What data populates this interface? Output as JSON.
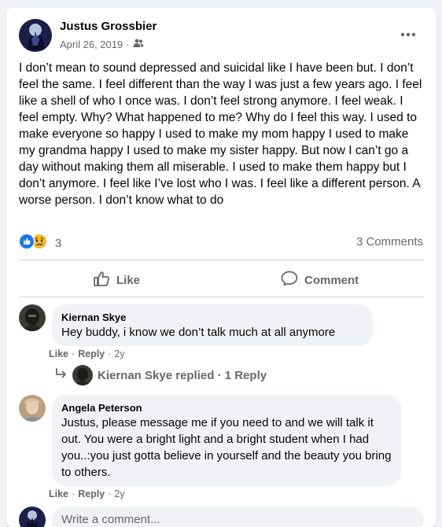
{
  "post": {
    "author": "Justus Grossbier",
    "date": "April 26, 2019",
    "separator": "·",
    "audience_icon": "friends-icon",
    "text": "I don’t mean to sound depressed and suicidal like I have been but. I don’t feel the same. I feel different than the way I was just a few years ago. I feel like a shell of who I once was. I don’t feel strong anymore. I feel weak. I feel empty. Why? What happened to me? Why do I feel this way. I used to make everyone so happy I used to make my mom happy I used to make my grandma happy I used to make my sister happy. But now I can’t go a day without making them all miserable. I used to make them happy but I don’t anymore. I feel like I’ve lost who I was. I feel like a different person. A worse person. I don’t know what to do",
    "reaction_count": "3",
    "comment_count": "3 Comments",
    "reaction_icons": [
      "like-icon",
      "sad-icon"
    ]
  },
  "actions": {
    "like": "Like",
    "comment": "Comment"
  },
  "comments": [
    {
      "name": "Kiernan Skye",
      "text": "Hey buddy, i know we don’t talk much at all anymore",
      "like": "Like",
      "reply": "Reply",
      "dot": "·",
      "time": "2y"
    },
    {
      "name": "Angela Peterson",
      "text": "Justus, please message me if you need to and we will talk it out. You were a bright light and a bright student when I had you..:you just gotta believe in yourself and the beauty you bring to others.",
      "like": "Like",
      "reply": "Reply",
      "dot": "·",
      "time": "2y"
    }
  ],
  "reply_thread": {
    "text": "Kiernan Skye replied · 1 Reply"
  },
  "write_comment": {
    "placeholder": "Write a comment..."
  },
  "colors": {
    "like_blue": "#1877f2",
    "sad_yellow": "#f7b928",
    "secondary_text": "#65676b"
  }
}
